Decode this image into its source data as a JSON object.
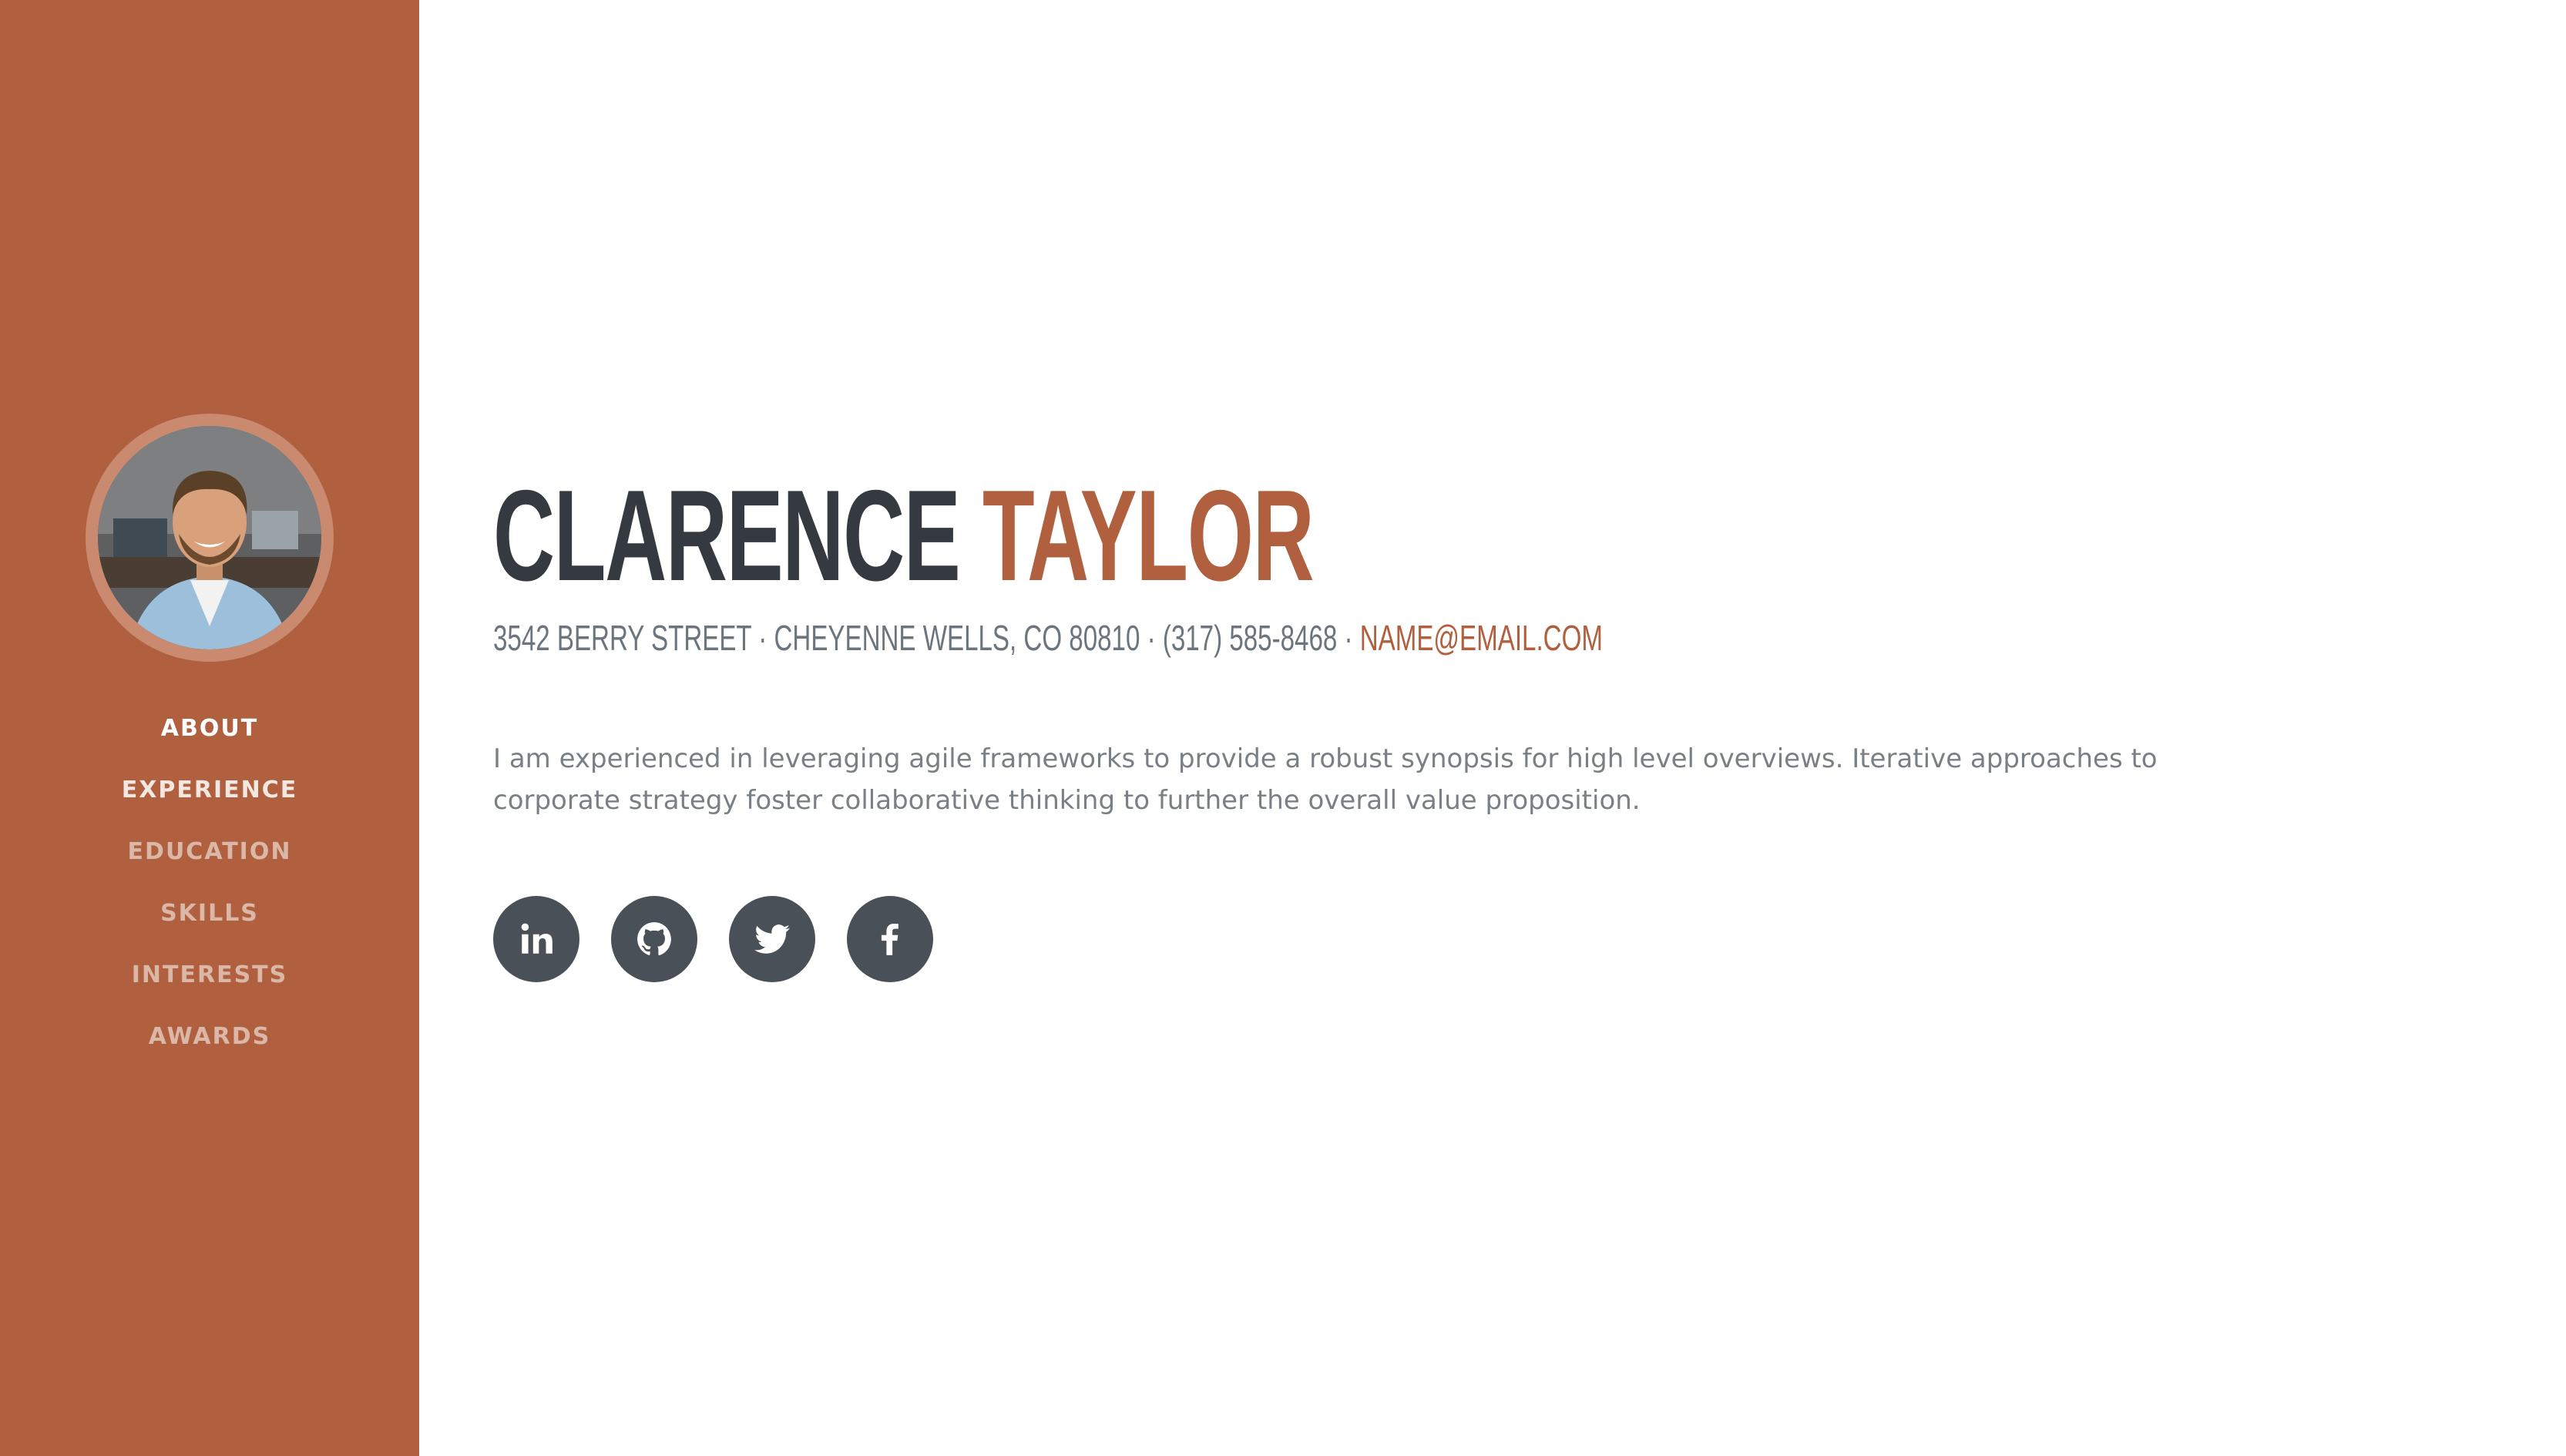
{
  "nav": {
    "items": [
      {
        "label": "ABOUT"
      },
      {
        "label": "EXPERIENCE"
      },
      {
        "label": "EDUCATION"
      },
      {
        "label": "SKILLS"
      },
      {
        "label": "INTERESTS"
      },
      {
        "label": "AWARDS"
      }
    ],
    "active": "ABOUT"
  },
  "profile": {
    "first_name": "CLARENCE",
    "last_name": "TAYLOR",
    "address": "3542 Berry Street · Cheyenne Wells, CO 80810 · (317) 585-8468 ·",
    "email": "name@email.com",
    "about": "I am experienced in leveraging agile frameworks to provide a robust synopsis for high level overviews. Iterative approaches to corporate strategy foster collaborative thinking to further the overall value proposition."
  },
  "social": [
    {
      "icon": "linkedin-icon"
    },
    {
      "icon": "github-icon"
    },
    {
      "icon": "twitter-icon"
    },
    {
      "icon": "facebook-icon"
    }
  ],
  "colors": {
    "primary": "#b0603e",
    "dark": "#343a40",
    "muted": "#6c757d",
    "social_bg": "#495057"
  }
}
